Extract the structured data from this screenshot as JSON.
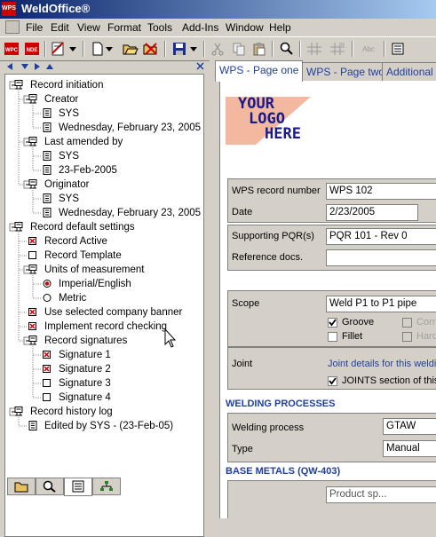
{
  "app": {
    "title": "WeldOffice®",
    "icon_label": "WPS"
  },
  "menu": [
    "File",
    "Edit",
    "View",
    "Format",
    "Tools",
    "Add-Ins",
    "Window",
    "Help"
  ],
  "toolbar": {
    "buttons": [
      "wpc-icon",
      "nde-icon",
      "report-icon",
      "new-icon",
      "open-icon",
      "delete-icon",
      "save-icon",
      "cut-icon",
      "copy-icon",
      "paste-icon",
      "find-icon",
      "grid-icon",
      "grid-alt-icon",
      "spell-icon",
      "properties-icon"
    ],
    "button_texts": {
      "wpc": "WPC",
      "nde": "NDE",
      "spell": "Abc"
    }
  },
  "tree": {
    "items": [
      {
        "label": "Record initiation",
        "icon": "record-icon",
        "level": 0
      },
      {
        "label": "Creator",
        "icon": "record-icon",
        "level": 1
      },
      {
        "label": "SYS",
        "icon": "document-icon",
        "level": 2
      },
      {
        "label": "Wednesday, February 23, 2005",
        "icon": "document-icon",
        "level": 2
      },
      {
        "label": "Last amended by",
        "icon": "record-icon",
        "level": 1
      },
      {
        "label": "SYS",
        "icon": "document-icon",
        "level": 2
      },
      {
        "label": "23-Feb-2005",
        "icon": "document-icon",
        "level": 2
      },
      {
        "label": "Originator",
        "icon": "record-icon",
        "level": 1
      },
      {
        "label": "SYS",
        "icon": "document-icon",
        "level": 2
      },
      {
        "label": "Wednesday, February 23, 2005",
        "icon": "document-icon",
        "level": 2
      },
      {
        "label": "Record default settings",
        "icon": "record-icon",
        "level": 0
      },
      {
        "label": "Record Active",
        "icon": "checked-box-icon",
        "level": 1
      },
      {
        "label": "Record Template",
        "icon": "unchecked-box-icon",
        "level": 1
      },
      {
        "label": "Units of measurement",
        "icon": "record-icon",
        "level": 1
      },
      {
        "label": "Imperial/English",
        "icon": "radio-selected-icon",
        "level": 2
      },
      {
        "label": "Metric",
        "icon": "radio-empty-icon",
        "level": 2
      },
      {
        "label": "Use selected company banner",
        "icon": "checked-box-icon",
        "level": 1
      },
      {
        "label": "Implement record checking",
        "icon": "checked-box-icon",
        "level": 1
      },
      {
        "label": "Record signatures",
        "icon": "record-icon",
        "level": 1
      },
      {
        "label": "Signature 1",
        "icon": "checked-box-icon",
        "level": 2
      },
      {
        "label": "Signature 2",
        "icon": "checked-box-icon",
        "level": 2
      },
      {
        "label": "Signature 3",
        "icon": "unchecked-box-icon",
        "level": 2
      },
      {
        "label": "Signature 4",
        "icon": "unchecked-box-icon",
        "level": 2
      },
      {
        "label": "Record history log",
        "icon": "record-icon",
        "level": 0
      },
      {
        "label": "Edited by SYS - (23-Feb-05)",
        "icon": "document-icon",
        "level": 1
      }
    ]
  },
  "bottom_tabs": [
    "folder-icon",
    "search-icon",
    "properties-icon",
    "hierarchy-icon"
  ],
  "tabs": [
    "WPS - Page one",
    "WPS - Page two",
    "Additional in"
  ],
  "logo": {
    "line1": "YOUR",
    "line2": "LOGO",
    "line3": "HERE"
  },
  "form": {
    "record_number_label": "WPS record number",
    "record_number": "WPS 102",
    "date_label": "Date",
    "date": "2/23/2005",
    "pqr_label": "Supporting PQR(s)",
    "pqr": "PQR 101 - Rev 0",
    "refdocs_label": "Reference docs.",
    "refdocs": "",
    "scope_label": "Scope",
    "scope": "Weld P1 to P1 pipe",
    "groove_label": "Groove",
    "fillet_label": "Fillet",
    "corr_label": "Corro",
    "hard_label": "Hard",
    "joint_label": "Joint",
    "joint_link": "Joint details for this weldin",
    "joints_label": "JOINTS section of this"
  },
  "sections": {
    "welding_processes": "WELDING PROCESSES",
    "base_metals": "BASE METALS (QW-403)"
  },
  "processes": {
    "process_label": "Welding process",
    "process": "GTAW",
    "type_label": "Type",
    "type": "Manual"
  },
  "base_metals_fragment": "Product sp..."
}
